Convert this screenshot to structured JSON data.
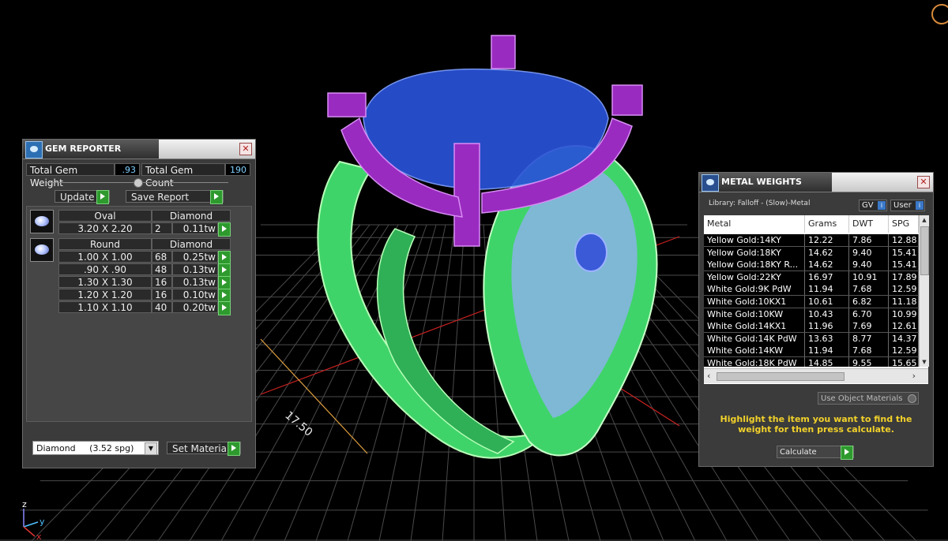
{
  "gem_reporter": {
    "title": "GEM REPORTER",
    "total_weight_label": "Total Gem Weight",
    "total_weight_value": ".93",
    "total_count_label": "Total Gem Count",
    "total_count_value": "190",
    "update_label": "Update",
    "save_report_label": "Save Report",
    "groups": [
      {
        "shape": "Oval",
        "material": "Diamond",
        "rows": [
          {
            "size": "3.20 X 2.20",
            "count": "2",
            "weight": "0.11tw"
          }
        ]
      },
      {
        "shape": "Round",
        "material": "Diamond",
        "rows": [
          {
            "size": "1.00 X 1.00",
            "count": "68",
            "weight": "0.25tw"
          },
          {
            "size": ".90 X .90",
            "count": "48",
            "weight": "0.13tw"
          },
          {
            "size": "1.30 X 1.30",
            "count": "16",
            "weight": "0.13tw"
          },
          {
            "size": "1.20 X 1.20",
            "count": "16",
            "weight": "0.10tw"
          },
          {
            "size": "1.10 X 1.10",
            "count": "40",
            "weight": "0.20tw"
          }
        ]
      }
    ],
    "material_select": "Diamond     (3.52 spg)",
    "set_material_label": "Set Material"
  },
  "metal_weights": {
    "title": "METAL WEIGHTS",
    "library_label": "Library: Falloff - (Slow)-Metal",
    "gv_label": "GV",
    "user_label": "User",
    "columns": [
      "Metal",
      "Grams",
      "DWT",
      "SPG"
    ],
    "rows": [
      [
        "Yellow Gold:14KY",
        "12.22",
        "7.86",
        "12.88"
      ],
      [
        "Yellow Gold:18KY",
        "14.62",
        "9.40",
        "15.41"
      ],
      [
        "Yellow Gold:18KY R...",
        "14.62",
        "9.40",
        "15.41"
      ],
      [
        "Yellow Gold:22KY",
        "16.97",
        "10.91",
        "17.89"
      ],
      [
        "White Gold:9K PdW",
        "11.94",
        "7.68",
        "12.59"
      ],
      [
        "White Gold:10KX1",
        "10.61",
        "6.82",
        "11.18"
      ],
      [
        "White Gold:10KW",
        "10.43",
        "6.70",
        "10.99"
      ],
      [
        "White Gold:14KX1",
        "11.96",
        "7.69",
        "12.61"
      ],
      [
        "White Gold:14K PdW",
        "13.63",
        "8.77",
        "14.37"
      ],
      [
        "White Gold:14KW",
        "11.94",
        "7.68",
        "12.59"
      ],
      [
        "White Gold:18K PdW",
        "14.85",
        "9.55",
        "15.65"
      ]
    ],
    "use_object_materials": "Use Object Materials",
    "instruction": "Highlight the item you want to find the weight for then press calculate.",
    "calculate_label": "Calculate"
  },
  "viewport": {
    "dimension_label": "17.50",
    "axis_z": "z",
    "axis_y": "y",
    "axis_x": "x"
  },
  "colors": {
    "prongs": "#9a2bc0",
    "gem": "#2a52d8",
    "band": "#3fd46a",
    "grid": "#4a4a4a"
  }
}
